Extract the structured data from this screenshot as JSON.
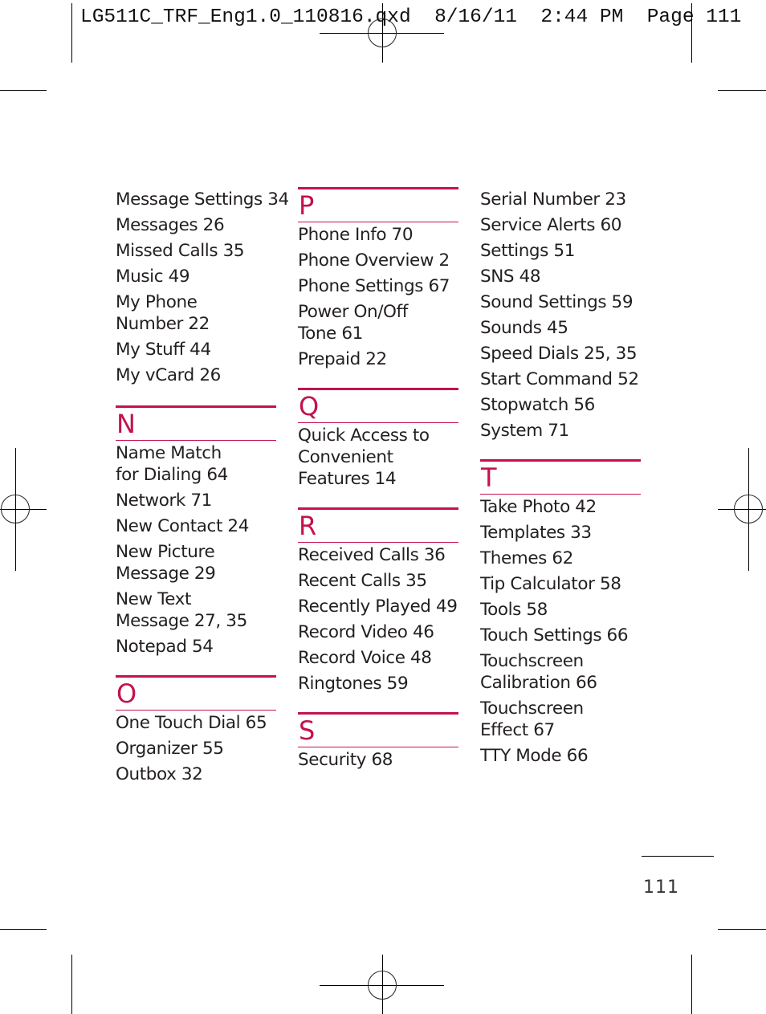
{
  "slug_line": "LG511C_TRF_Eng1.0_110816.qxd  8/16/11  2:44 PM  Page 111",
  "accent_color": "#c4124d",
  "columns": [
    {
      "continuation": [
        "Message Settings 34",
        "Messages 26",
        "Missed Calls 35",
        "Music 49",
        "My Phone Number 22",
        "My Stuff 44",
        "My vCard 26"
      ],
      "sections": [
        {
          "letter": "N",
          "entries": [
            "Name Match for Dialing 64",
            "Network 71",
            "New Contact 24",
            "New Picture Message 29",
            "New Text Message 27, 35",
            "Notepad 54"
          ]
        },
        {
          "letter": "O",
          "entries": [
            "One Touch Dial 65",
            "Organizer 55",
            "Outbox 32"
          ]
        }
      ]
    },
    {
      "continuation": [],
      "sections": [
        {
          "letter": "P",
          "entries": [
            "Phone Info 70",
            "Phone Overview 2",
            "Phone Settings 67",
            "Power On/Off Tone 61",
            "Prepaid 22"
          ]
        },
        {
          "letter": "Q",
          "entries": [
            "Quick Access to Convenient Features 14"
          ]
        },
        {
          "letter": "R",
          "entries": [
            "Received Calls 36",
            "Recent Calls 35",
            "Recently Played 49",
            "Record Video 46",
            "Record Voice 48",
            "Ringtones 59"
          ]
        },
        {
          "letter": "S",
          "entries": [
            "Security 68"
          ]
        }
      ]
    },
    {
      "continuation": [
        "Serial Number 23",
        "Service Alerts 60",
        "Settings 51",
        "SNS 48",
        "Sound Settings 59",
        "Sounds 45",
        "Speed Dials 25, 35",
        "Start Command 52",
        "Stopwatch 56",
        "System 71"
      ],
      "sections": [
        {
          "letter": "T",
          "entries": [
            "Take Photo 42",
            "Templates 33",
            "Themes 62",
            "Tip Calculator 58",
            "Tools 58",
            "Touch Settings 66",
            "Touchscreen Calibration 66",
            "Touchscreen Effect 67",
            "TTY Mode 66"
          ]
        }
      ]
    }
  ],
  "page_number": "111"
}
